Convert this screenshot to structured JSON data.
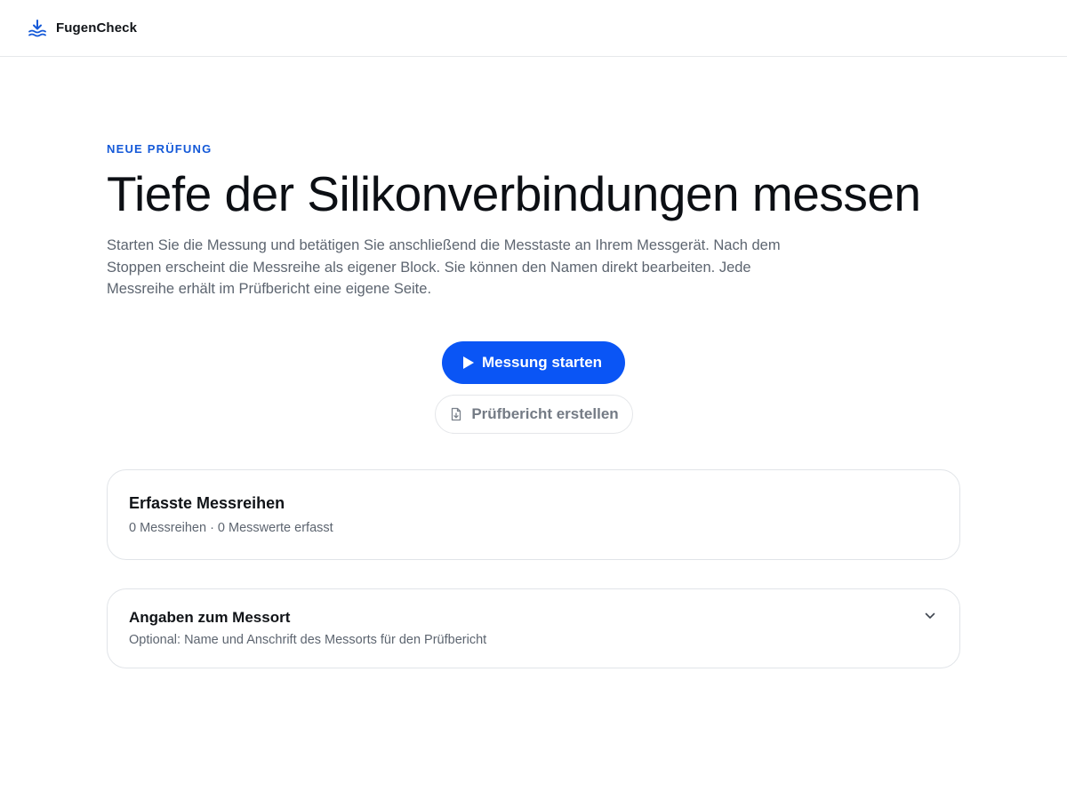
{
  "app": {
    "name": "FugenCheck",
    "logo_icon": "ruler-down-waves-icon",
    "accent_color": "#0a55f5"
  },
  "hero": {
    "eyebrow": "Neue Prüfung",
    "title": "Tiefe der Silikonverbindungen messen",
    "intro": "Starten Sie die Messung und betätigen Sie anschließend die Messtaste an Ihrem Messgerät. Nach dem Stoppen erscheint die Messreihe als eigener Block. Sie können den Namen direkt bearbeiten. Jede Messreihe erhält im Prüfbericht eine eigene Seite."
  },
  "actions": {
    "start_label": "Messung starten",
    "start_icon": "play-icon",
    "report_label": "Prüfbericht erstellen",
    "report_icon": "file-download-icon",
    "report_enabled": false
  },
  "series_card": {
    "title": "Erfasste Messreihen",
    "summary": "0 Messreihen · 0 Messwerte erfasst"
  },
  "location_card": {
    "title": "Angaben zum Messort",
    "subtitle": "Optional: Name und Anschrift des Messorts für den Prüfbericht",
    "expand_icon": "chevron-down-icon",
    "expanded": false
  }
}
